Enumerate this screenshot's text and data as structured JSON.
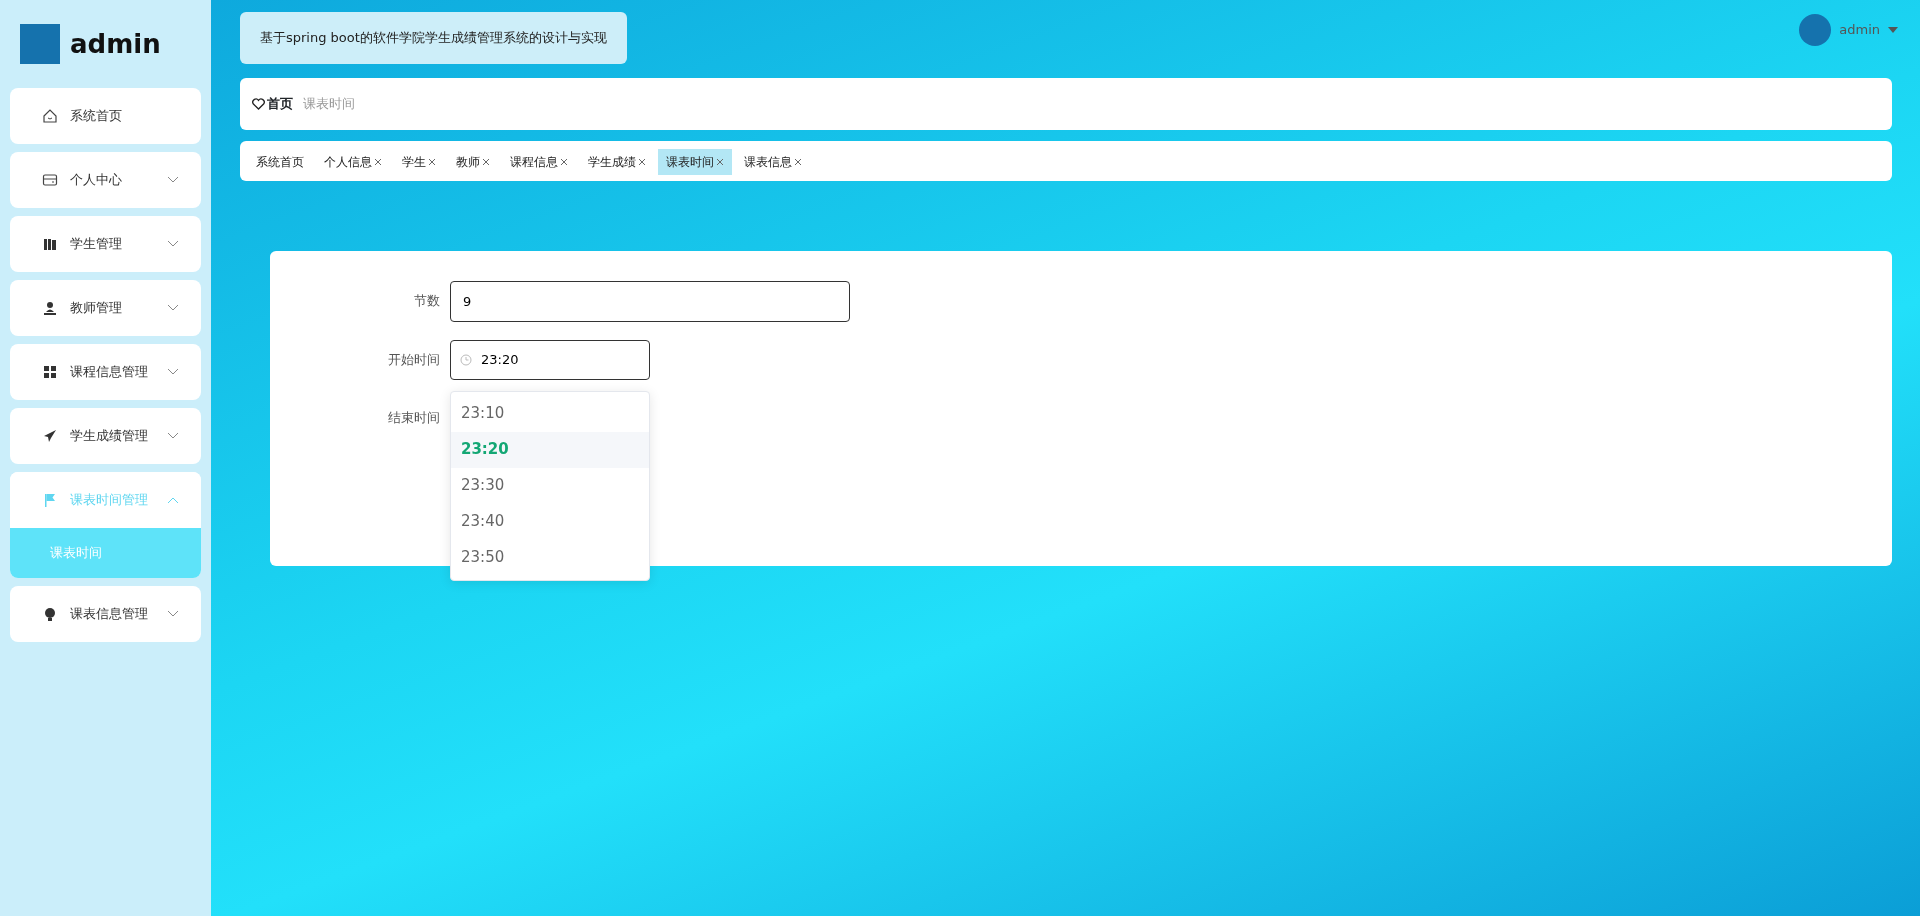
{
  "sidebar": {
    "user": "admin",
    "menu": [
      {
        "label": "系统首页",
        "expandable": false,
        "expanded": false
      },
      {
        "label": "个人中心",
        "expandable": true,
        "expanded": false
      },
      {
        "label": "学生管理",
        "expandable": true,
        "expanded": false
      },
      {
        "label": "教师管理",
        "expandable": true,
        "expanded": false
      },
      {
        "label": "课程信息管理",
        "expandable": true,
        "expanded": false
      },
      {
        "label": "学生成绩管理",
        "expandable": true,
        "expanded": false
      },
      {
        "label": "课表时间管理",
        "expandable": true,
        "expanded": true,
        "children": [
          {
            "label": "课表时间",
            "selected": true
          }
        ]
      },
      {
        "label": "课表信息管理",
        "expandable": true,
        "expanded": false
      }
    ]
  },
  "header": {
    "title": "基于spring boot的软件学院学生成绩管理系统的设计与实现",
    "user": "admin"
  },
  "breadcrumb": [
    "首页",
    "课表时间"
  ],
  "tabs": [
    {
      "label": "系统首页",
      "closable": false,
      "selected": false
    },
    {
      "label": "个人信息",
      "closable": true,
      "selected": false
    },
    {
      "label": "学生",
      "closable": true,
      "selected": false
    },
    {
      "label": "教师",
      "closable": true,
      "selected": false
    },
    {
      "label": "课程信息",
      "closable": true,
      "selected": false
    },
    {
      "label": "学生成绩",
      "closable": true,
      "selected": false
    },
    {
      "label": "课表时间",
      "closable": true,
      "selected": true
    },
    {
      "label": "课表信息",
      "closable": true,
      "selected": false
    }
  ],
  "form": {
    "fields": [
      {
        "label": "节数",
        "kind": "text",
        "value": "9"
      },
      {
        "label": "开始时间",
        "kind": "time",
        "value": "23:20"
      },
      {
        "label": "结束时间",
        "kind": "empty"
      }
    ],
    "time_options": [
      {
        "label": "23:10",
        "selected": false
      },
      {
        "label": "23:20",
        "selected": true
      },
      {
        "label": "23:30",
        "selected": false
      },
      {
        "label": "23:40",
        "selected": false
      },
      {
        "label": "23:50",
        "selected": false
      }
    ]
  }
}
